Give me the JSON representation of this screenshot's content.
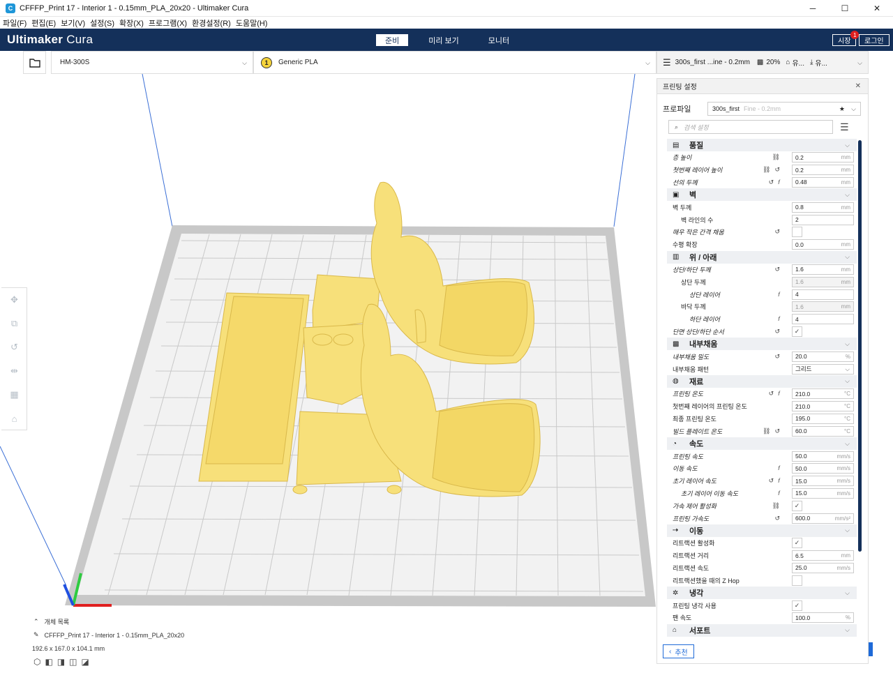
{
  "window": {
    "title": "CFFFP_Print 17 - Interior 1 - 0.15mm_PLA_20x20 - Ultimaker Cura",
    "minimize": "─",
    "maximize": "☐",
    "close": "✕"
  },
  "menu": [
    "파일(F)",
    "편집(E)",
    "보기(V)",
    "설정(S)",
    "확장(X)",
    "프로그램(X)",
    "환경설정(R)",
    "도움말(H)"
  ],
  "header": {
    "brand_bold": "Ultimaker",
    "brand_rest": " Cura",
    "stages": [
      "준비",
      "미리 보기",
      "모니터"
    ],
    "active_stage": 0,
    "marketplace": "시장",
    "badge": "1",
    "login": "로그인"
  },
  "toolbar": {
    "printer": "HM-300S",
    "extruder_num": "1",
    "material": "Generic PLA",
    "profile_summary": "300s_first ...ine - 0.2mm",
    "infill": "20%",
    "support": "유...",
    "adhesion": "유..."
  },
  "object_list": {
    "toggle": "개체 목록",
    "name": "CFFFP_Print 17 - Interior 1 - 0.15mm_PLA_20x20",
    "dims": "192.6 x 167.0 x 104.1 mm"
  },
  "panel": {
    "title": "프린팅 설정",
    "profile_label": "프로파일",
    "profile_value": "300s_first",
    "profile_sub": "Fine - 0.2mm",
    "search_placeholder": "검색 설정",
    "recommend": "추천",
    "items": [
      {
        "kind": "cat",
        "icon": "quality-icon",
        "glyph": "▤",
        "label": "품질"
      },
      {
        "kind": "row",
        "label": "층 높이",
        "italic": true,
        "indent": 0,
        "icons": [
          "link-icon"
        ],
        "value": "0.2",
        "unit": "mm"
      },
      {
        "kind": "row",
        "label": "첫번째 레이어 높이",
        "italic": true,
        "indent": 0,
        "icons": [
          "link-icon",
          "reset-icon"
        ],
        "value": "0.2",
        "unit": "mm"
      },
      {
        "kind": "row",
        "label": "선의 두께",
        "italic": true,
        "indent": 0,
        "icons": [
          "reset-icon",
          "function-icon"
        ],
        "value": "0.48",
        "unit": "mm"
      },
      {
        "kind": "cat",
        "icon": "walls-icon",
        "glyph": "▣",
        "label": "벽"
      },
      {
        "kind": "row",
        "label": "벽 두께",
        "italic": false,
        "indent": 0,
        "icons": [],
        "value": "0.8",
        "unit": "mm"
      },
      {
        "kind": "row",
        "label": "벽 라인의 수",
        "italic": false,
        "indent": 1,
        "icons": [],
        "value": "2",
        "unit": ""
      },
      {
        "kind": "row",
        "label": "매우 작은 간격 채움",
        "italic": true,
        "indent": 0,
        "icons": [
          "reset-icon"
        ],
        "check": ""
      },
      {
        "kind": "row",
        "label": "수평 확장",
        "italic": false,
        "indent": 0,
        "icons": [],
        "value": "0.0",
        "unit": "mm"
      },
      {
        "kind": "cat",
        "icon": "topbottom-icon",
        "glyph": "▥",
        "label": "위 / 아래"
      },
      {
        "kind": "row",
        "label": "상단/하단 두께",
        "italic": true,
        "indent": 0,
        "icons": [
          "reset-icon"
        ],
        "value": "1.6",
        "unit": "mm"
      },
      {
        "kind": "row",
        "label": "상단 두께",
        "italic": false,
        "indent": 1,
        "icons": [],
        "value": "1.6",
        "unit": "mm",
        "disabled": true
      },
      {
        "kind": "row",
        "label": "상단 레이어",
        "italic": true,
        "indent": 2,
        "icons": [
          "function-icon"
        ],
        "value": "4",
        "unit": ""
      },
      {
        "kind": "row",
        "label": "바닥 두께",
        "italic": false,
        "indent": 1,
        "icons": [],
        "value": "1.6",
        "unit": "mm",
        "disabled": true
      },
      {
        "kind": "row",
        "label": "하단 레이어",
        "italic": true,
        "indent": 2,
        "icons": [
          "function-icon"
        ],
        "value": "4",
        "unit": ""
      },
      {
        "kind": "row",
        "label": "단면 상단/하단 순서",
        "italic": true,
        "indent": 0,
        "icons": [
          "reset-icon"
        ],
        "check": "✓"
      },
      {
        "kind": "cat",
        "icon": "infill-icon",
        "glyph": "▩",
        "label": "내부채움"
      },
      {
        "kind": "row",
        "label": "내부채움 밀도",
        "italic": true,
        "indent": 0,
        "icons": [
          "reset-icon"
        ],
        "value": "20.0",
        "unit": "%"
      },
      {
        "kind": "row",
        "label": "내부채움 패턴",
        "italic": false,
        "indent": 0,
        "icons": [],
        "select": "그리드"
      },
      {
        "kind": "cat",
        "icon": "material-icon",
        "glyph": "◍",
        "label": "재료"
      },
      {
        "kind": "row",
        "label": "프린팅 온도",
        "italic": true,
        "indent": 0,
        "icons": [
          "reset-icon",
          "function-icon"
        ],
        "value": "210.0",
        "unit": "°C"
      },
      {
        "kind": "row",
        "label": "첫번째 레이어의 프린팅 온도",
        "italic": false,
        "indent": 0,
        "icons": [],
        "value": "210.0",
        "unit": "°C"
      },
      {
        "kind": "row",
        "label": "최종 프린팅 온도",
        "italic": false,
        "indent": 0,
        "icons": [],
        "value": "195.0",
        "unit": "°C"
      },
      {
        "kind": "row",
        "label": "빌드 플레이트 온도",
        "italic": true,
        "indent": 0,
        "icons": [
          "link-icon",
          "reset-icon"
        ],
        "value": "60.0",
        "unit": "°C"
      },
      {
        "kind": "cat",
        "icon": "speed-icon",
        "glyph": "◔",
        "label": "속도"
      },
      {
        "kind": "row",
        "label": "프린팅 속도",
        "italic": true,
        "indent": 0,
        "icons": [],
        "value": "50.0",
        "unit": "mm/s"
      },
      {
        "kind": "row",
        "label": "이동 속도",
        "italic": true,
        "indent": 0,
        "icons": [
          "function-icon"
        ],
        "value": "50.0",
        "unit": "mm/s"
      },
      {
        "kind": "row",
        "label": "초기 레이어 속도",
        "italic": true,
        "indent": 0,
        "icons": [
          "reset-icon",
          "function-icon"
        ],
        "value": "15.0",
        "unit": "mm/s"
      },
      {
        "kind": "row",
        "label": "초기 레이어 이동 속도",
        "italic": true,
        "indent": 1,
        "icons": [
          "function-icon"
        ],
        "value": "15.0",
        "unit": "mm/s"
      },
      {
        "kind": "row",
        "label": "가속 제어 활성화",
        "italic": true,
        "indent": 0,
        "icons": [
          "link-icon"
        ],
        "check": "✓"
      },
      {
        "kind": "row",
        "label": "프린팅 가속도",
        "italic": true,
        "indent": 0,
        "icons": [
          "reset-icon"
        ],
        "value": "600.0",
        "unit": "mm/s²"
      },
      {
        "kind": "cat",
        "icon": "travel-icon",
        "glyph": "⇢",
        "label": "이동"
      },
      {
        "kind": "row",
        "label": "리트랙션 활성화",
        "italic": false,
        "indent": 0,
        "icons": [],
        "check": "✓"
      },
      {
        "kind": "row",
        "label": "리트랙션 거리",
        "italic": false,
        "indent": 0,
        "icons": [],
        "value": "6.5",
        "unit": "mm"
      },
      {
        "kind": "row",
        "label": "리트랙션 속도",
        "italic": false,
        "indent": 0,
        "icons": [],
        "value": "25.0",
        "unit": "mm/s"
      },
      {
        "kind": "row",
        "label": "리트랙션했을 때의 Z Hop",
        "italic": false,
        "indent": 0,
        "icons": [],
        "check": ""
      },
      {
        "kind": "cat",
        "icon": "cooling-icon",
        "glyph": "✲",
        "label": "냉각"
      },
      {
        "kind": "row",
        "label": "프린팅 냉각 사용",
        "italic": false,
        "indent": 0,
        "icons": [],
        "check": "✓"
      },
      {
        "kind": "row",
        "label": "팬 속도",
        "italic": false,
        "indent": 0,
        "icons": [],
        "value": "100.0",
        "unit": "%"
      },
      {
        "kind": "cat",
        "icon": "support-icon",
        "glyph": "⌂",
        "label": "서포트"
      }
    ]
  },
  "colors": {
    "header": "#14305a",
    "model": "#f7e07a",
    "plate_line": "#c9c9c9",
    "accent": "#1e6ad8"
  }
}
